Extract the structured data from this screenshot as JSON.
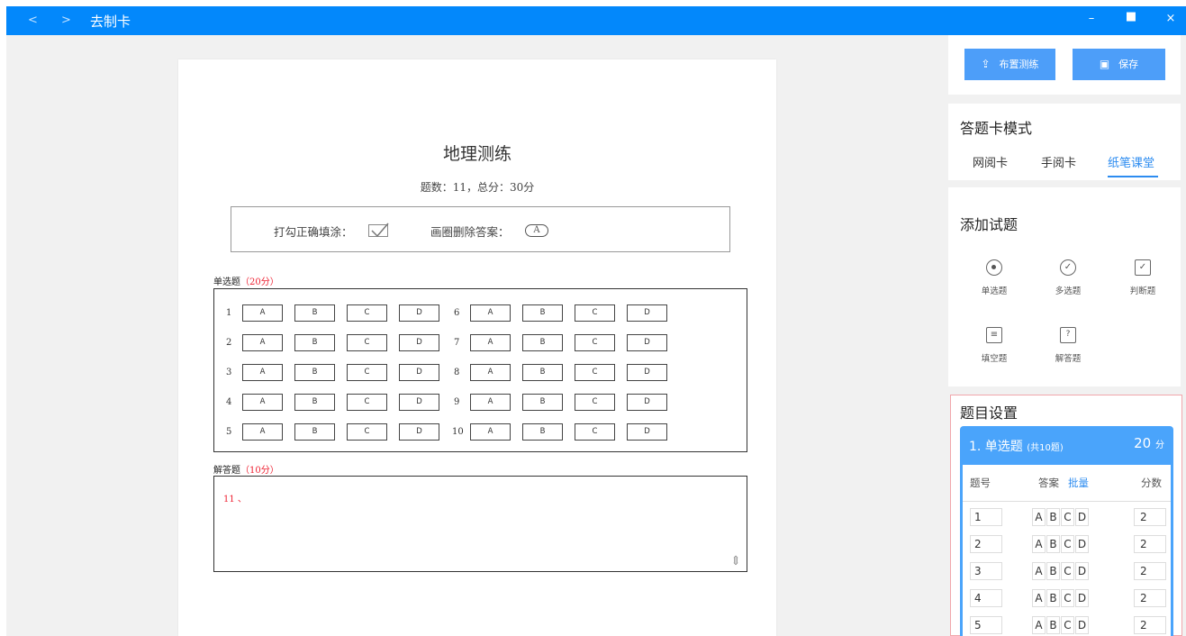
{
  "window": {
    "back": "<",
    "forward": ">",
    "title": "去制卡",
    "minimize": "–",
    "maximize": "▫",
    "close": "×"
  },
  "paper": {
    "title": "地理测练",
    "summary": "题数：11，总分：30分",
    "legend": {
      "tick_label": "打勾正确填涂：",
      "circle_label": "画圈删除答案：",
      "circle_letter": "A"
    },
    "choice_section": {
      "name": "单选题",
      "points": "（20分）",
      "left_numbers": [
        "1",
        "2",
        "3",
        "4",
        "5"
      ],
      "right_numbers": [
        "6",
        "7",
        "8",
        "9",
        "10"
      ],
      "options": [
        "A",
        "B",
        "C",
        "D"
      ]
    },
    "answer_section": {
      "name": "解答题",
      "points": "（10分）",
      "item": "11 、"
    }
  },
  "sidebar": {
    "publish_button": "布置测练",
    "save_button": "保存",
    "mode_title": "答题卡模式",
    "modes": [
      "网阅卡",
      "手阅卡",
      "纸笔课堂"
    ],
    "active_mode": "纸笔课堂",
    "add_title": "添加试题",
    "question_types": [
      {
        "label": "单选题",
        "icon": "radio-icon"
      },
      {
        "label": "多选题",
        "icon": "check-circle-icon"
      },
      {
        "label": "判断题",
        "icon": "judge-icon"
      },
      {
        "label": "填空题",
        "icon": "fill-blank-icon"
      },
      {
        "label": "解答题",
        "icon": "answer-icon"
      }
    ],
    "settings": {
      "title": "题目设置",
      "section_name": "1. 单选题",
      "section_count": "(共10题)",
      "section_score": "20",
      "section_score_unit": "分",
      "col_number": "题号",
      "col_answer": "答案",
      "col_batch": "批量",
      "col_score": "分数",
      "rows": [
        {
          "n": "1",
          "score": "2"
        },
        {
          "n": "2",
          "score": "2"
        },
        {
          "n": "3",
          "score": "2"
        },
        {
          "n": "4",
          "score": "2"
        },
        {
          "n": "5",
          "score": "2"
        }
      ],
      "answer_letters": [
        "A",
        "B",
        "C",
        "D"
      ]
    }
  },
  "colors": {
    "titlebar": "#0388fb",
    "accent": "#2d8cf0",
    "points": "#e23333",
    "section_header": "#4aa4fb"
  }
}
